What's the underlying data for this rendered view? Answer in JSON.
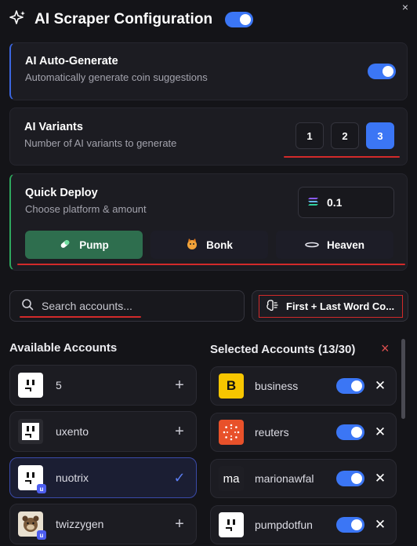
{
  "header": {
    "title": "AI Scraper Configuration",
    "enabled": true,
    "close_glyph": "×"
  },
  "auto_generate": {
    "title": "AI Auto-Generate",
    "subtitle": "Automatically generate coin suggestions",
    "enabled": true
  },
  "variants": {
    "title": "AI Variants",
    "subtitle": "Number of AI variants to generate",
    "options": [
      "1",
      "2",
      "3"
    ],
    "selected": "3"
  },
  "quick_deploy": {
    "title": "Quick Deploy",
    "subtitle": "Choose platform & amount",
    "amount": "0.1",
    "platforms": [
      {
        "label": "Pump",
        "icon": "pill-icon",
        "active": true
      },
      {
        "label": "Bonk",
        "icon": "dog-icon",
        "active": false
      },
      {
        "label": "Heaven",
        "icon": "halo-icon",
        "active": false
      }
    ]
  },
  "search": {
    "placeholder": "Search accounts..."
  },
  "mode_button": {
    "label": "First + Last Word Co..."
  },
  "available": {
    "heading": "Available Accounts",
    "items": [
      {
        "name": "5",
        "action": "+",
        "selected": false
      },
      {
        "name": "uxento",
        "action": "+",
        "selected": false
      },
      {
        "name": "nuotrix",
        "action": "✓",
        "selected": true,
        "badge": "u"
      },
      {
        "name": "twizzygen",
        "action": "+",
        "selected": false,
        "badge": "u"
      }
    ]
  },
  "selected": {
    "heading": "Selected Accounts (13/30)",
    "clear_glyph": "×",
    "items": [
      {
        "name": "business",
        "enabled": true,
        "avatar_text": "B"
      },
      {
        "name": "reuters",
        "enabled": true,
        "avatar_text": ""
      },
      {
        "name": "marionawfal",
        "enabled": true,
        "avatar_text": "ma"
      },
      {
        "name": "pumpdotfun",
        "enabled": true,
        "avatar_text": ""
      }
    ]
  },
  "colors": {
    "accent": "#3b76f5",
    "pump_active": "#2e6e4e",
    "annotation_red": "#d22a2a",
    "clear_red": "#e05050"
  }
}
